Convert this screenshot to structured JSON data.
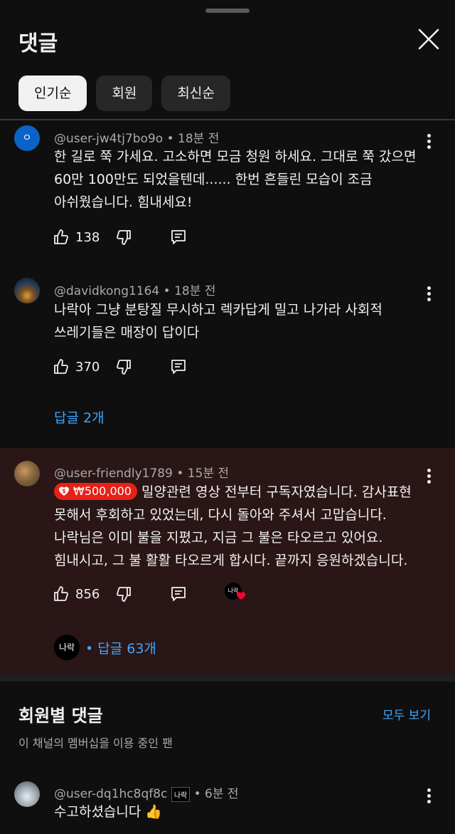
{
  "sheet": {
    "title": "댓글"
  },
  "tabs": [
    {
      "label": "인기순",
      "active": true
    },
    {
      "label": "회원",
      "active": false
    },
    {
      "label": "최신순",
      "active": false
    }
  ],
  "comments": [
    {
      "author": "@user-jw4tj7bo9o",
      "time": "18분 전",
      "lines": [
        "한 길로 쭉 가세요. 고소하면 모금 청원 하세요. 그대로 쭉 갔으면",
        "60만 100만도 되었을텐데...... 한번 흔들린 모습이 조금",
        "아쉬웠습니다. 힘내세요!"
      ],
      "likes": "138",
      "avatar_letter": "ㅇ"
    },
    {
      "author": "@davidkong1164",
      "time": "18분 전",
      "lines": [
        "나락아 그냥 분탕질 무시하고 렉카답게 밀고 나가라 사회적",
        "쓰레기들은 매장이 답이다"
      ],
      "likes": "370",
      "replies": "답글 2개"
    },
    {
      "author": "@user-friendly1789",
      "time": "15분 전",
      "super_amount": "₩500,000",
      "first_line": "밀양관련 영상 전부터 구독자였습니다. 감사표현",
      "lines": [
        "못해서 후회하고 있었는데, 다시 돌아와 주셔서 고맙습니다.",
        "나락님은 이미 불을 지폈고, 지금 그 불은 타오르고 있어요.",
        "힘내시고, 그 불 활활 타오르게 합시다. 끝까지 응원하겠습니다."
      ],
      "likes": "856",
      "creator_badge": "나락",
      "replies": "• 답글 63개"
    }
  ],
  "members_section": {
    "title": "회원별 댓글",
    "subtitle": "이 채널의 멤버십을 이용 중인 팬",
    "see_all": "모두 보기",
    "comment": {
      "author": "@user-dq1hc8qf8c",
      "member_badge": "나락",
      "time": "• 6분 전",
      "text": "수고하셨습니다",
      "emoji": "👍"
    }
  },
  "sep": "•",
  "colors": {
    "background": "#0f0f0f",
    "link": "#3ea6ff",
    "superchat": "#e62117",
    "donation_bg": "#2a1616"
  }
}
